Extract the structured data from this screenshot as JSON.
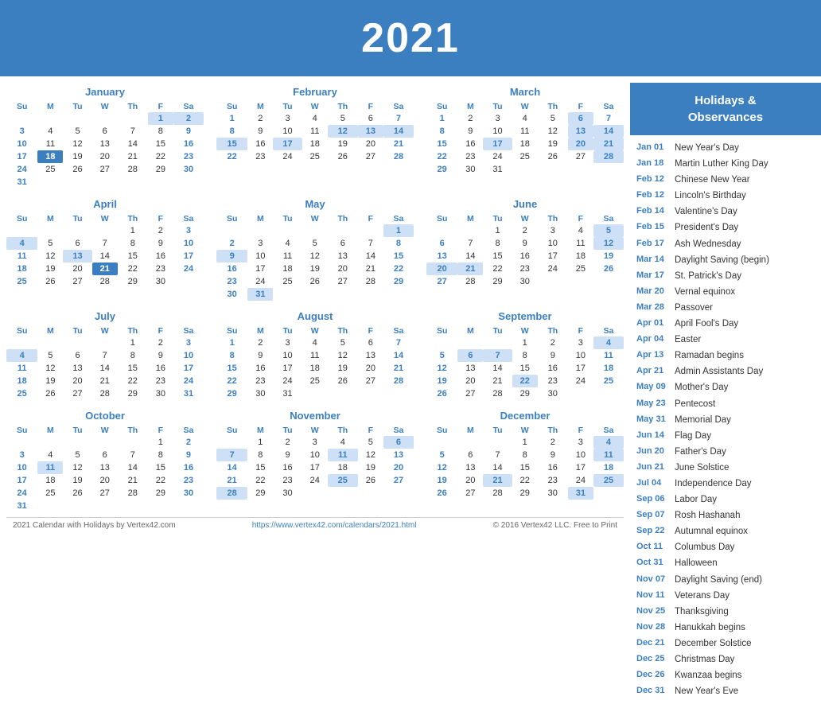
{
  "header": {
    "year": "2021"
  },
  "sidebar": {
    "title": "Holidays &\nObservances",
    "holidays": [
      {
        "date": "Jan 01",
        "name": "New Year's Day"
      },
      {
        "date": "Jan 18",
        "name": "Martin Luther King Day"
      },
      {
        "date": "Feb 12",
        "name": "Chinese New Year"
      },
      {
        "date": "Feb 12",
        "name": "Lincoln's Birthday"
      },
      {
        "date": "Feb 14",
        "name": "Valentine's Day"
      },
      {
        "date": "Feb 15",
        "name": "President's Day"
      },
      {
        "date": "Feb 17",
        "name": "Ash Wednesday"
      },
      {
        "date": "Mar 14",
        "name": "Daylight Saving (begin)"
      },
      {
        "date": "Mar 17",
        "name": "St. Patrick's Day"
      },
      {
        "date": "Mar 20",
        "name": "Vernal equinox"
      },
      {
        "date": "Mar 28",
        "name": "Passover"
      },
      {
        "date": "Apr 01",
        "name": "April Fool's Day"
      },
      {
        "date": "Apr 04",
        "name": "Easter"
      },
      {
        "date": "Apr 13",
        "name": "Ramadan begins"
      },
      {
        "date": "Apr 21",
        "name": "Admin Assistants Day"
      },
      {
        "date": "May 09",
        "name": "Mother's Day"
      },
      {
        "date": "May 23",
        "name": "Pentecost"
      },
      {
        "date": "May 31",
        "name": "Memorial Day"
      },
      {
        "date": "Jun 14",
        "name": "Flag Day"
      },
      {
        "date": "Jun 20",
        "name": "Father's Day"
      },
      {
        "date": "Jun 21",
        "name": "June Solstice"
      },
      {
        "date": "Jul 04",
        "name": "Independence Day"
      },
      {
        "date": "Sep 06",
        "name": "Labor Day"
      },
      {
        "date": "Sep 07",
        "name": "Rosh Hashanah"
      },
      {
        "date": "Sep 22",
        "name": "Autumnal equinox"
      },
      {
        "date": "Oct 11",
        "name": "Columbus Day"
      },
      {
        "date": "Oct 31",
        "name": "Halloween"
      },
      {
        "date": "Nov 07",
        "name": "Daylight Saving (end)"
      },
      {
        "date": "Nov 11",
        "name": "Veterans Day"
      },
      {
        "date": "Nov 25",
        "name": "Thanksgiving"
      },
      {
        "date": "Nov 28",
        "name": "Hanukkah begins"
      },
      {
        "date": "Dec 21",
        "name": "December Solstice"
      },
      {
        "date": "Dec 25",
        "name": "Christmas Day"
      },
      {
        "date": "Dec 26",
        "name": "Kwanzaa begins"
      },
      {
        "date": "Dec 31",
        "name": "New Year's Eve"
      }
    ]
  },
  "footer": {
    "left": "2021 Calendar with Holidays by Vertex42.com",
    "center": "https://www.vertex42.com/calendars/2021.html",
    "right": "© 2016 Vertex42 LLC. Free to Print"
  },
  "months": [
    {
      "name": "January",
      "days": [
        [
          null,
          null,
          null,
          null,
          null,
          "1",
          "2"
        ],
        [
          "3",
          "4",
          "5",
          "6",
          "7",
          "8",
          "9"
        ],
        [
          "10",
          "11",
          "12",
          "13",
          "14",
          "15",
          "16"
        ],
        [
          "17",
          "18",
          "19",
          "20",
          "21",
          "22",
          "23"
        ],
        [
          "24",
          "25",
          "26",
          "27",
          "28",
          "29",
          "30"
        ],
        [
          "31",
          null,
          null,
          null,
          null,
          null,
          null
        ]
      ],
      "highlights": [
        "1",
        "2"
      ],
      "todays": [
        "18"
      ]
    },
    {
      "name": "February",
      "days": [
        [
          "1",
          "2",
          "3",
          "4",
          "5",
          "6",
          "7"
        ],
        [
          "8",
          "9",
          "10",
          "11",
          "12",
          "13",
          "14"
        ],
        [
          "15",
          "16",
          "17",
          "18",
          "19",
          "20",
          "21"
        ],
        [
          "22",
          "23",
          "24",
          "25",
          "26",
          "27",
          "28"
        ]
      ],
      "highlights": [
        "12",
        "13",
        "14",
        "15",
        "17"
      ],
      "todays": []
    },
    {
      "name": "March",
      "days": [
        [
          "1",
          "2",
          "3",
          "4",
          "5",
          "6",
          "7"
        ],
        [
          "8",
          "9",
          "10",
          "11",
          "12",
          "13",
          "14"
        ],
        [
          "15",
          "16",
          "17",
          "18",
          "19",
          "20",
          "21"
        ],
        [
          "22",
          "23",
          "24",
          "25",
          "26",
          "27",
          "28"
        ],
        [
          "29",
          "30",
          "31",
          null,
          null,
          null,
          null
        ]
      ],
      "highlights": [
        "6",
        "13",
        "14",
        "17",
        "20",
        "21",
        "28"
      ],
      "todays": []
    },
    {
      "name": "April",
      "days": [
        [
          null,
          null,
          null,
          null,
          "1",
          "2",
          "3"
        ],
        [
          "4",
          "5",
          "6",
          "7",
          "8",
          "9",
          "10"
        ],
        [
          "11",
          "12",
          "13",
          "14",
          "15",
          "16",
          "17"
        ],
        [
          "18",
          "19",
          "20",
          "21",
          "22",
          "23",
          "24"
        ],
        [
          "25",
          "26",
          "27",
          "28",
          "29",
          "30",
          null
        ]
      ],
      "highlights": [
        "4",
        "13"
      ],
      "todays": [
        "21"
      ]
    },
    {
      "name": "May",
      "days": [
        [
          null,
          null,
          null,
          null,
          null,
          null,
          "1"
        ],
        [
          "2",
          "3",
          "4",
          "5",
          "6",
          "7",
          "8"
        ],
        [
          "9",
          "10",
          "11",
          "12",
          "13",
          "14",
          "15"
        ],
        [
          "16",
          "17",
          "18",
          "19",
          "20",
          "21",
          "22"
        ],
        [
          "23",
          "24",
          "25",
          "26",
          "27",
          "28",
          "29"
        ],
        [
          "30",
          "31",
          null,
          null,
          null,
          null,
          null
        ]
      ],
      "highlights": [
        "1",
        "9",
        "31"
      ],
      "todays": []
    },
    {
      "name": "June",
      "days": [
        [
          null,
          null,
          "1",
          "2",
          "3",
          "4",
          "5"
        ],
        [
          "6",
          "7",
          "8",
          "9",
          "10",
          "11",
          "12"
        ],
        [
          "13",
          "14",
          "15",
          "16",
          "17",
          "18",
          "19"
        ],
        [
          "20",
          "21",
          "22",
          "23",
          "24",
          "25",
          "26"
        ],
        [
          "27",
          "28",
          "29",
          "30",
          null,
          null,
          null
        ]
      ],
      "highlights": [
        "5",
        "12",
        "20",
        "21"
      ],
      "todays": []
    },
    {
      "name": "July",
      "days": [
        [
          null,
          null,
          null,
          null,
          "1",
          "2",
          "3"
        ],
        [
          "4",
          "5",
          "6",
          "7",
          "8",
          "9",
          "10"
        ],
        [
          "11",
          "12",
          "13",
          "14",
          "15",
          "16",
          "17"
        ],
        [
          "18",
          "19",
          "20",
          "21",
          "22",
          "23",
          "24"
        ],
        [
          "25",
          "26",
          "27",
          "28",
          "29",
          "30",
          "31"
        ]
      ],
      "highlights": [
        "4"
      ],
      "todays": []
    },
    {
      "name": "August",
      "days": [
        [
          "1",
          "2",
          "3",
          "4",
          "5",
          "6",
          "7"
        ],
        [
          "8",
          "9",
          "10",
          "11",
          "12",
          "13",
          "14"
        ],
        [
          "15",
          "16",
          "17",
          "18",
          "19",
          "20",
          "21"
        ],
        [
          "22",
          "23",
          "24",
          "25",
          "26",
          "27",
          "28"
        ],
        [
          "29",
          "30",
          "31",
          null,
          null,
          null,
          null
        ]
      ],
      "highlights": [],
      "todays": []
    },
    {
      "name": "September",
      "days": [
        [
          null,
          null,
          null,
          "1",
          "2",
          "3",
          "4"
        ],
        [
          "5",
          "6",
          "7",
          "8",
          "9",
          "10",
          "11"
        ],
        [
          "12",
          "13",
          "14",
          "15",
          "16",
          "17",
          "18"
        ],
        [
          "19",
          "20",
          "21",
          "22",
          "23",
          "24",
          "25"
        ],
        [
          "26",
          "27",
          "28",
          "29",
          "30",
          null,
          null
        ]
      ],
      "highlights": [
        "4",
        "6",
        "7",
        "22"
      ],
      "todays": []
    },
    {
      "name": "October",
      "days": [
        [
          null,
          null,
          null,
          null,
          null,
          "1",
          "2"
        ],
        [
          "3",
          "4",
          "5",
          "6",
          "7",
          "8",
          "9"
        ],
        [
          "10",
          "11",
          "12",
          "13",
          "14",
          "15",
          "16"
        ],
        [
          "17",
          "18",
          "19",
          "20",
          "21",
          "22",
          "23"
        ],
        [
          "24",
          "25",
          "26",
          "27",
          "28",
          "29",
          "30"
        ],
        [
          "31",
          null,
          null,
          null,
          null,
          null,
          null
        ]
      ],
      "highlights": [
        "11"
      ],
      "todays": []
    },
    {
      "name": "November",
      "days": [
        [
          null,
          "1",
          "2",
          "3",
          "4",
          "5",
          "6"
        ],
        [
          "7",
          "8",
          "9",
          "10",
          "11",
          "12",
          "13"
        ],
        [
          "14",
          "15",
          "16",
          "17",
          "18",
          "19",
          "20"
        ],
        [
          "21",
          "22",
          "23",
          "24",
          "25",
          "26",
          "27"
        ],
        [
          "28",
          "29",
          "30",
          null,
          null,
          null,
          null
        ]
      ],
      "highlights": [
        "6",
        "7",
        "11",
        "25",
        "28"
      ],
      "todays": []
    },
    {
      "name": "December",
      "days": [
        [
          null,
          null,
          null,
          "1",
          "2",
          "3",
          "4"
        ],
        [
          "5",
          "6",
          "7",
          "8",
          "9",
          "10",
          "11"
        ],
        [
          "12",
          "13",
          "14",
          "15",
          "16",
          "17",
          "18"
        ],
        [
          "19",
          "20",
          "21",
          "22",
          "23",
          "24",
          "25"
        ],
        [
          "26",
          "27",
          "28",
          "29",
          "30",
          "31",
          null
        ]
      ],
      "highlights": [
        "4",
        "11",
        "21",
        "25",
        "31"
      ],
      "todays": []
    }
  ]
}
